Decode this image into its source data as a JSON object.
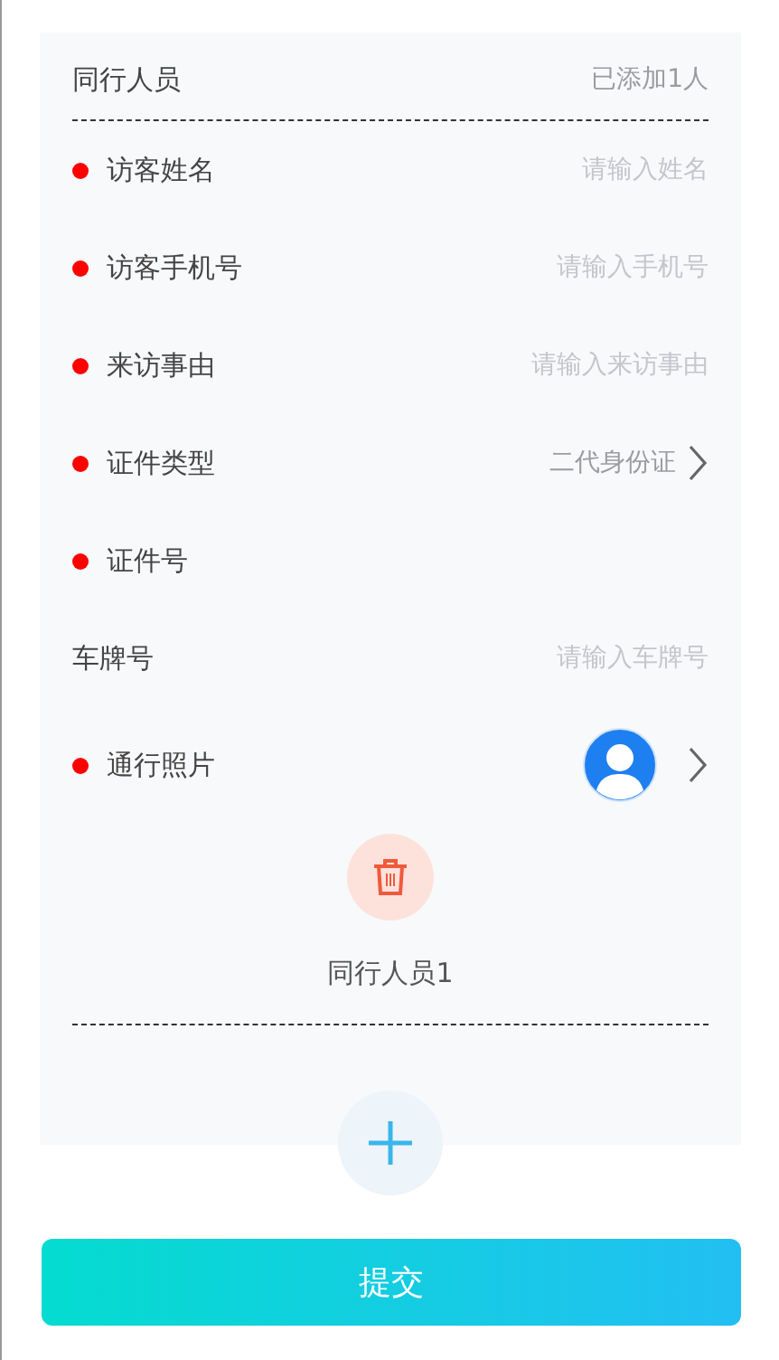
{
  "companions": {
    "label": "同行人员",
    "count": "已添加1人"
  },
  "fields": [
    {
      "kind": "input",
      "label": "访客姓名",
      "required": true,
      "placeholder": "请输入姓名"
    },
    {
      "kind": "input",
      "label": "访客手机号",
      "required": true,
      "placeholder": "请输入手机号"
    },
    {
      "kind": "input",
      "label": "来访事由",
      "required": true,
      "placeholder": "请输入来访事由"
    },
    {
      "kind": "select",
      "label": "证件类型",
      "required": true,
      "value": "二代身份证"
    },
    {
      "kind": "input",
      "label": "证件号",
      "required": true
    },
    {
      "kind": "input",
      "label": "车牌号",
      "required": false,
      "placeholder": "请输入车牌号"
    },
    {
      "kind": "photo",
      "label": "通行照片",
      "required": true
    }
  ],
  "companion_title": "同行人员1",
  "submit": "提交"
}
